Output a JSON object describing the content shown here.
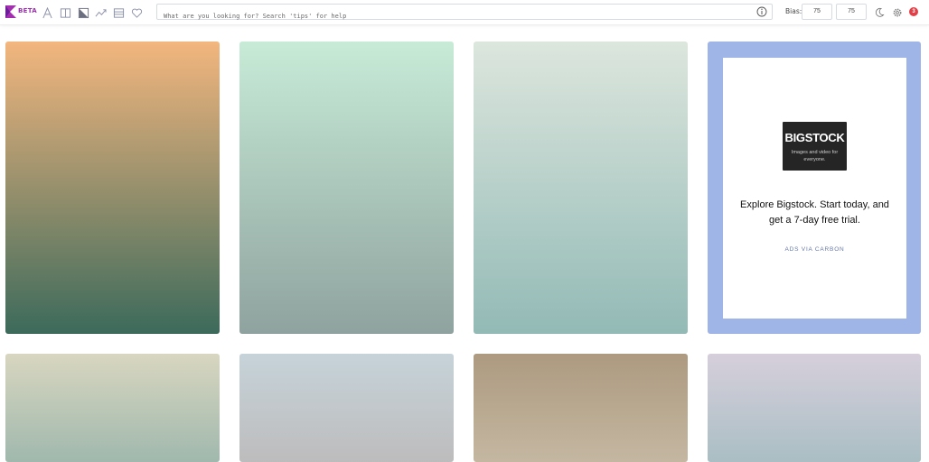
{
  "header": {
    "beta_label": "BETA",
    "nav_icons": [
      "font-icon",
      "columns-icon",
      "image-icon",
      "shuffle-icon",
      "layout-icon",
      "heart-icon"
    ],
    "search": {
      "placeholder": "What are you looking for? Search 'tips' for help",
      "value": ""
    },
    "bias_label": "Bias:",
    "bias_values": [
      "75",
      "75"
    ],
    "notification_count": "3"
  },
  "gradients": [
    {
      "from": "#f3b67e",
      "to": "#3c6a5b"
    },
    {
      "from": "#c7ebd7",
      "to": "#8fa29f"
    },
    {
      "from": "#dce6dd",
      "to": "#93bab6"
    },
    {
      "from": "#d8d6c0",
      "to": "#a0b8ad"
    },
    {
      "from": "#c6d3d9",
      "to": "#bdbcbd"
    },
    {
      "from": "#ad9a80",
      "to": "#c4b7a1"
    },
    {
      "from": "#d6cfdb",
      "to": "#aabec4"
    }
  ],
  "ad": {
    "brand": "BIGSTOCK",
    "brand_tagline": "Images and video for everyone.",
    "text": "Explore Bigstock. Start today, and get a 7-day free trial.",
    "via_label": "ADS VIA CARBON"
  },
  "colors": {
    "accent": "#9b2fae",
    "ad_background": "#9fb5e7",
    "notification": "#e04048"
  }
}
